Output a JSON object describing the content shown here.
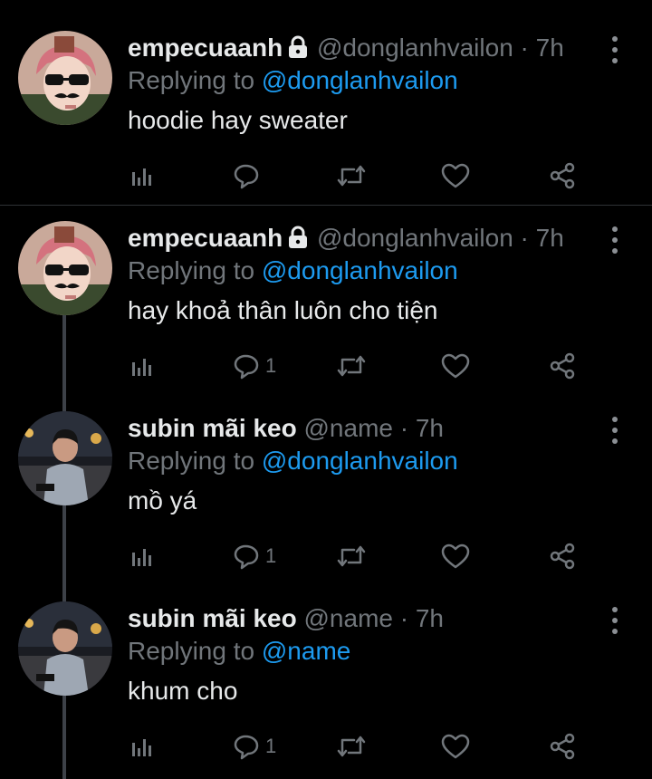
{
  "tweets": [
    {
      "name": "empecuaanh",
      "protected": true,
      "handle": "@donglanhvailon",
      "dot": "·",
      "time": "7h",
      "replying_prefix": "Replying to",
      "replying_to": "@donglanhvailon",
      "text": "hoodie hay sweater",
      "reply_count": "",
      "avatar": "pink-hair-sunglasses-mustache"
    },
    {
      "name": "empecuaanh",
      "protected": true,
      "handle": "@donglanhvailon",
      "dot": "·",
      "time": "7h",
      "replying_prefix": "Replying to",
      "replying_to": "@donglanhvailon",
      "text": "hay khoả thân luôn cho tiện",
      "reply_count": "1",
      "avatar": "pink-hair-sunglasses-mustache"
    },
    {
      "name": "subin mãi keo",
      "protected": false,
      "handle": "@name",
      "dot": "·",
      "time": "7h",
      "replying_prefix": "Replying to",
      "replying_to": "@donglanhvailon",
      "text": "mồ yá",
      "reply_count": "1",
      "avatar": "night-street-photo"
    },
    {
      "name": "subin mãi keo",
      "protected": false,
      "handle": "@name",
      "dot": "·",
      "time": "7h",
      "replying_prefix": "Replying to",
      "replying_to": "@name",
      "text": "khum cho",
      "reply_count": "1",
      "avatar": "night-street-photo"
    }
  ],
  "icons": {
    "analytics": "bar-chart-icon",
    "reply": "speech-bubble-icon",
    "retweet": "retweet-icon",
    "like": "heart-icon",
    "share": "share-icon",
    "more": "vertical-dots-icon",
    "lock": "lock-icon"
  },
  "colors": {
    "background": "#000000",
    "text": "#e7e9ea",
    "muted": "#71767b",
    "link": "#1d9bf0",
    "divider": "#2f3336",
    "thread_line": "#3d4148"
  }
}
